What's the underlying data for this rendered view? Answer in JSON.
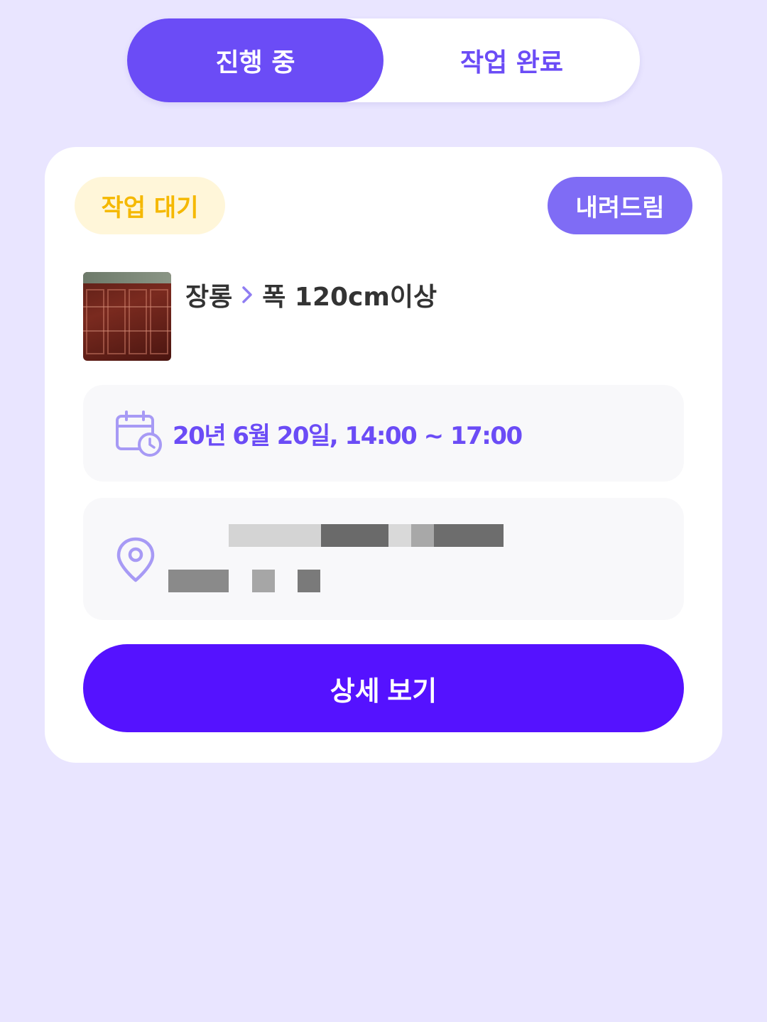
{
  "tabs": {
    "active_label": "진행 중",
    "inactive_label": "작업 완료"
  },
  "card": {
    "status_badge": "작업 대기",
    "type_badge": "내려드림",
    "category": "장롱",
    "sub_category": "폭 120cm이상",
    "datetime": "20년 6월 20일, 14:00 ~ 17:00",
    "detail_button": "상세 보기"
  },
  "icons": {
    "chevron": "chevron-right-icon",
    "calendar": "calendar-clock-icon",
    "location": "location-pin-icon"
  },
  "colors": {
    "background": "#e9e5ff",
    "primary": "#6b4cf6",
    "button": "#5512ff",
    "status_badge_bg": "#fff6d9",
    "status_badge_text": "#f5b800",
    "type_badge_bg": "#7f6cf5"
  }
}
